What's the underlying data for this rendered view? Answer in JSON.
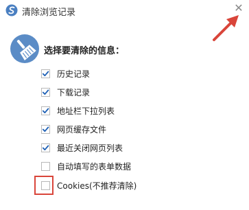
{
  "window": {
    "title": "清除浏览记录",
    "close_symbol": "✕"
  },
  "icons": {
    "app": "browser-app-icon",
    "brush": "broom-clean-icon",
    "close": "close-icon",
    "annotation_arrow": "red-arrow-icon"
  },
  "section": {
    "heading": "选择要清除的信息："
  },
  "options": [
    {
      "label": "历史记录",
      "checked": true
    },
    {
      "label": "下载记录",
      "checked": true
    },
    {
      "label": "地址栏下拉列表",
      "checked": true
    },
    {
      "label": "网页缓存文件",
      "checked": true
    },
    {
      "label": "最近关闭网页列表",
      "checked": true
    },
    {
      "label": "自动填写的表单数据",
      "checked": false
    },
    {
      "label": "Cookies(不推荐清除)",
      "checked": false
    }
  ],
  "colors": {
    "accent_red": "#d9453a",
    "icon_blue": "#5b8cc6",
    "check_blue": "#1c5fb5"
  }
}
